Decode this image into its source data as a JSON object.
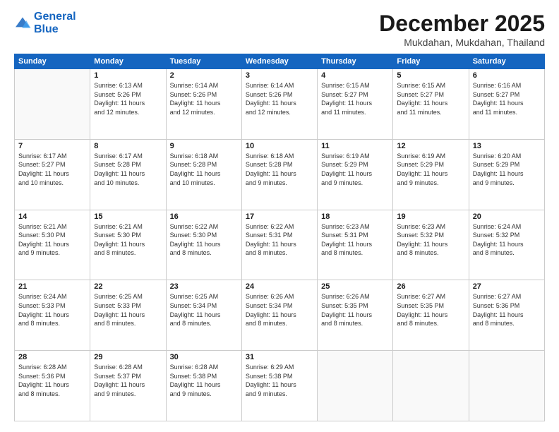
{
  "logo": {
    "line1": "General",
    "line2": "Blue"
  },
  "header": {
    "month": "December 2025",
    "location": "Mukdahan, Mukdahan, Thailand"
  },
  "weekdays": [
    "Sunday",
    "Monday",
    "Tuesday",
    "Wednesday",
    "Thursday",
    "Friday",
    "Saturday"
  ],
  "weeks": [
    [
      {
        "day": "",
        "info": ""
      },
      {
        "day": "1",
        "info": "Sunrise: 6:13 AM\nSunset: 5:26 PM\nDaylight: 11 hours\nand 12 minutes."
      },
      {
        "day": "2",
        "info": "Sunrise: 6:14 AM\nSunset: 5:26 PM\nDaylight: 11 hours\nand 12 minutes."
      },
      {
        "day": "3",
        "info": "Sunrise: 6:14 AM\nSunset: 5:26 PM\nDaylight: 11 hours\nand 12 minutes."
      },
      {
        "day": "4",
        "info": "Sunrise: 6:15 AM\nSunset: 5:27 PM\nDaylight: 11 hours\nand 11 minutes."
      },
      {
        "day": "5",
        "info": "Sunrise: 6:15 AM\nSunset: 5:27 PM\nDaylight: 11 hours\nand 11 minutes."
      },
      {
        "day": "6",
        "info": "Sunrise: 6:16 AM\nSunset: 5:27 PM\nDaylight: 11 hours\nand 11 minutes."
      }
    ],
    [
      {
        "day": "7",
        "info": "Sunrise: 6:17 AM\nSunset: 5:27 PM\nDaylight: 11 hours\nand 10 minutes."
      },
      {
        "day": "8",
        "info": "Sunrise: 6:17 AM\nSunset: 5:28 PM\nDaylight: 11 hours\nand 10 minutes."
      },
      {
        "day": "9",
        "info": "Sunrise: 6:18 AM\nSunset: 5:28 PM\nDaylight: 11 hours\nand 10 minutes."
      },
      {
        "day": "10",
        "info": "Sunrise: 6:18 AM\nSunset: 5:28 PM\nDaylight: 11 hours\nand 9 minutes."
      },
      {
        "day": "11",
        "info": "Sunrise: 6:19 AM\nSunset: 5:29 PM\nDaylight: 11 hours\nand 9 minutes."
      },
      {
        "day": "12",
        "info": "Sunrise: 6:19 AM\nSunset: 5:29 PM\nDaylight: 11 hours\nand 9 minutes."
      },
      {
        "day": "13",
        "info": "Sunrise: 6:20 AM\nSunset: 5:29 PM\nDaylight: 11 hours\nand 9 minutes."
      }
    ],
    [
      {
        "day": "14",
        "info": "Sunrise: 6:21 AM\nSunset: 5:30 PM\nDaylight: 11 hours\nand 9 minutes."
      },
      {
        "day": "15",
        "info": "Sunrise: 6:21 AM\nSunset: 5:30 PM\nDaylight: 11 hours\nand 8 minutes."
      },
      {
        "day": "16",
        "info": "Sunrise: 6:22 AM\nSunset: 5:30 PM\nDaylight: 11 hours\nand 8 minutes."
      },
      {
        "day": "17",
        "info": "Sunrise: 6:22 AM\nSunset: 5:31 PM\nDaylight: 11 hours\nand 8 minutes."
      },
      {
        "day": "18",
        "info": "Sunrise: 6:23 AM\nSunset: 5:31 PM\nDaylight: 11 hours\nand 8 minutes."
      },
      {
        "day": "19",
        "info": "Sunrise: 6:23 AM\nSunset: 5:32 PM\nDaylight: 11 hours\nand 8 minutes."
      },
      {
        "day": "20",
        "info": "Sunrise: 6:24 AM\nSunset: 5:32 PM\nDaylight: 11 hours\nand 8 minutes."
      }
    ],
    [
      {
        "day": "21",
        "info": "Sunrise: 6:24 AM\nSunset: 5:33 PM\nDaylight: 11 hours\nand 8 minutes."
      },
      {
        "day": "22",
        "info": "Sunrise: 6:25 AM\nSunset: 5:33 PM\nDaylight: 11 hours\nand 8 minutes."
      },
      {
        "day": "23",
        "info": "Sunrise: 6:25 AM\nSunset: 5:34 PM\nDaylight: 11 hours\nand 8 minutes."
      },
      {
        "day": "24",
        "info": "Sunrise: 6:26 AM\nSunset: 5:34 PM\nDaylight: 11 hours\nand 8 minutes."
      },
      {
        "day": "25",
        "info": "Sunrise: 6:26 AM\nSunset: 5:35 PM\nDaylight: 11 hours\nand 8 minutes."
      },
      {
        "day": "26",
        "info": "Sunrise: 6:27 AM\nSunset: 5:35 PM\nDaylight: 11 hours\nand 8 minutes."
      },
      {
        "day": "27",
        "info": "Sunrise: 6:27 AM\nSunset: 5:36 PM\nDaylight: 11 hours\nand 8 minutes."
      }
    ],
    [
      {
        "day": "28",
        "info": "Sunrise: 6:28 AM\nSunset: 5:36 PM\nDaylight: 11 hours\nand 8 minutes."
      },
      {
        "day": "29",
        "info": "Sunrise: 6:28 AM\nSunset: 5:37 PM\nDaylight: 11 hours\nand 9 minutes."
      },
      {
        "day": "30",
        "info": "Sunrise: 6:28 AM\nSunset: 5:38 PM\nDaylight: 11 hours\nand 9 minutes."
      },
      {
        "day": "31",
        "info": "Sunrise: 6:29 AM\nSunset: 5:38 PM\nDaylight: 11 hours\nand 9 minutes."
      },
      {
        "day": "",
        "info": ""
      },
      {
        "day": "",
        "info": ""
      },
      {
        "day": "",
        "info": ""
      }
    ]
  ]
}
